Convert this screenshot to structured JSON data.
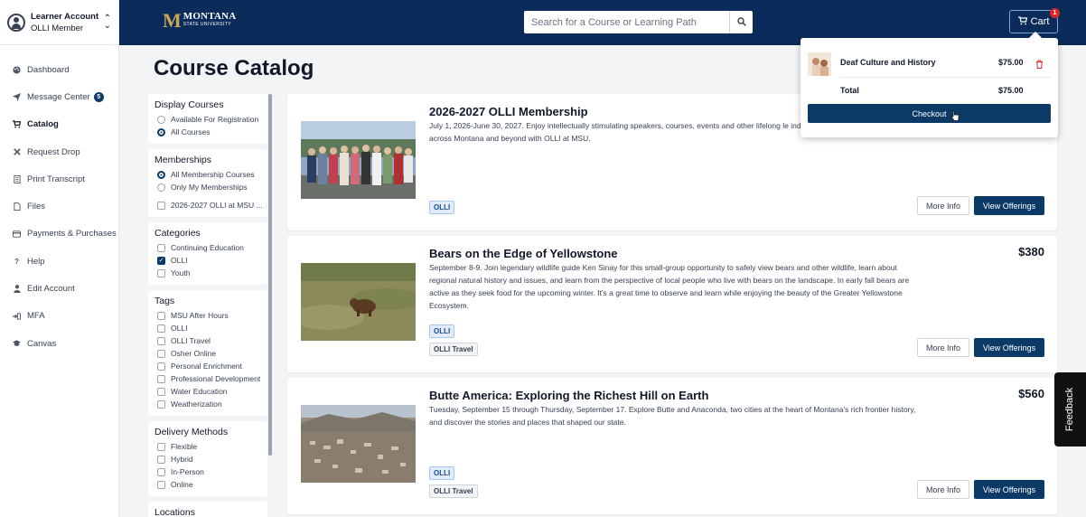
{
  "account": {
    "title": "Learner Account",
    "subtitle": "OLLI Member"
  },
  "sidebar": {
    "items": [
      {
        "label": "Dashboard",
        "icon": "palette-icon"
      },
      {
        "label": "Message Center",
        "icon": "paper-plane-icon",
        "badge": "5"
      },
      {
        "label": "Catalog",
        "icon": "cart-icon",
        "active": true
      },
      {
        "label": "Request Drop",
        "icon": "x-icon"
      },
      {
        "label": "Print Transcript",
        "icon": "document-icon"
      },
      {
        "label": "Files",
        "icon": "file-icon"
      },
      {
        "label": "Payments & Purchases",
        "icon": "credit-card-icon"
      },
      {
        "label": "Help",
        "icon": "question-icon"
      },
      {
        "label": "Edit Account",
        "icon": "user-icon"
      },
      {
        "label": "MFA",
        "icon": "mfa-icon"
      },
      {
        "label": "Canvas",
        "icon": "graduation-cap-icon"
      }
    ]
  },
  "header": {
    "logo_mark": "M",
    "logo_main": "MONTANA",
    "logo_sub": "STATE UNIVERSITY",
    "search_placeholder": "Search for a Course or Learning Path",
    "cart_label": "Cart",
    "cart_count": "1"
  },
  "page_title": "Course Catalog",
  "filters": {
    "display": {
      "title": "Display Courses",
      "options": [
        "Available For Registration",
        "All Courses"
      ],
      "selected": 1
    },
    "memberships": {
      "title": "Memberships",
      "options": [
        "All Membership Courses",
        "Only My Memberships"
      ],
      "selected": 0,
      "extra": "2026-2027 OLLI at MSU ..."
    },
    "categories": {
      "title": "Categories",
      "options": [
        "Continuing Education",
        "OLLI",
        "Youth"
      ],
      "checked": [
        false,
        true,
        false
      ]
    },
    "tags": {
      "title": "Tags",
      "options": [
        "MSU After Hours",
        "OLLI",
        "OLLI Travel",
        "Osher Online",
        "Personal Enrichment",
        "Professional Development",
        "Water Education",
        "Weatherization"
      ]
    },
    "delivery": {
      "title": "Delivery Methods",
      "options": [
        "Flexible",
        "Hybrid",
        "In-Person",
        "Online"
      ]
    },
    "locations": {
      "title": "Locations"
    }
  },
  "courses": [
    {
      "title": "2026-2027 OLLI Membership",
      "description": "July 1, 2026-June 30, 2027. Enjoy intellectually stimulating speakers, courses, events and other lifelong le individuals aged 50 and better across Montana and beyond with OLLI at MSU.",
      "price": "",
      "tags": [
        "OLLI"
      ]
    },
    {
      "title": "Bears on the Edge of Yellowstone",
      "description": "September 8-9. Join legendary wildlife guide Ken Sinay for this small-group opportunity to safely view bears and other wildlife, learn about regional natural history and issues, and learn from the perspective of local people who live with bears on the landscape. In early fall bears are active as they seek food for the upcoming winter. It's a great time to observe and learn while enjoying the beauty of the Greater Yellowstone Ecosystem.",
      "price": "$380",
      "tags": [
        "OLLI",
        "OLLI Travel"
      ]
    },
    {
      "title": "Butte America: Exploring the Richest Hill on Earth",
      "description": "Tuesday, September 15 through Thursday, September 17. Explore Butte and Anaconda, two cities at the heart of Montana's rich frontier history, and discover the stories and places that shaped our state.",
      "price": "$560",
      "tags": [
        "OLLI",
        "OLLI Travel"
      ]
    }
  ],
  "buttons": {
    "more_info": "More Info",
    "view_offerings": "View Offerings"
  },
  "cart_popup": {
    "item_name": "Deaf Culture and History",
    "item_price": "$75.00",
    "total_label": "Total",
    "total_value": "$75.00",
    "checkout_label": "Checkout"
  },
  "feedback_label": "Feedback",
  "colors": {
    "header": "#0b2c5a",
    "primary": "#0b3a66",
    "accent": "#c9a75b",
    "danger": "#dc2626"
  }
}
